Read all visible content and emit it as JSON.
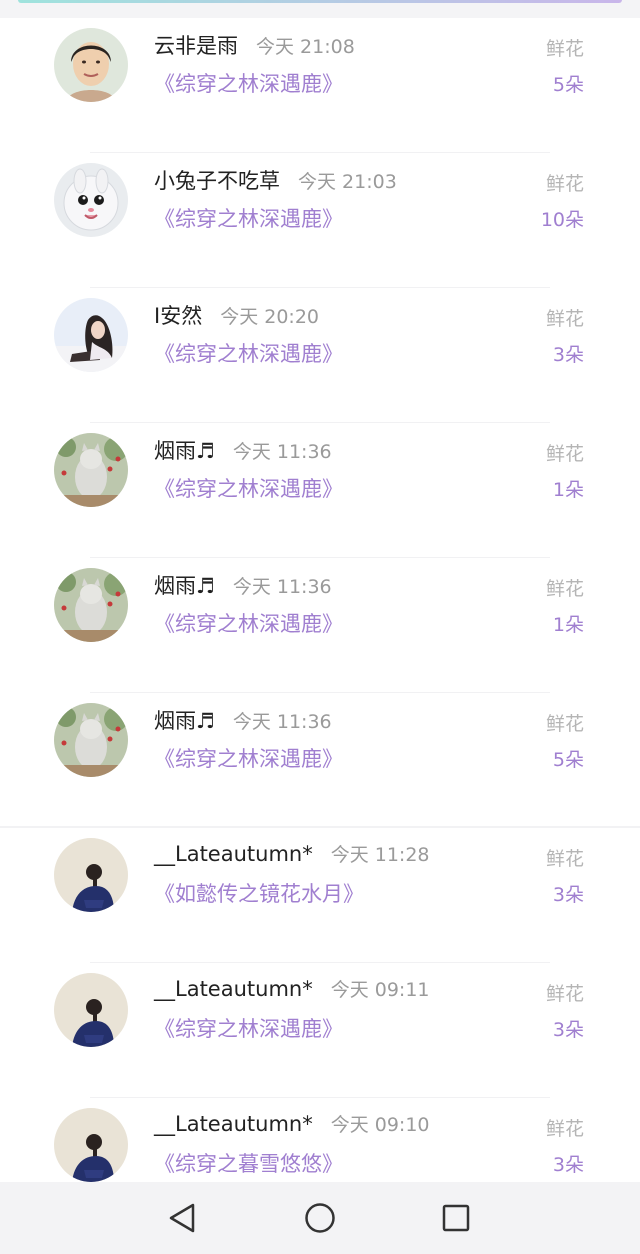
{
  "gift_records": [
    {
      "user": "云非是雨",
      "time": "今天 21:08",
      "book": "《综穿之林深遇鹿》",
      "gift_type": "鲜花",
      "count": "5朵"
    },
    {
      "user": "小兔子不吃草",
      "time": "今天 21:03",
      "book": "《综穿之林深遇鹿》",
      "gift_type": "鲜花",
      "count": "10朵"
    },
    {
      "user": "I安然",
      "time": "今天 20:20",
      "book": "《综穿之林深遇鹿》",
      "gift_type": "鲜花",
      "count": "3朵"
    },
    {
      "user": "烟雨♬",
      "time": "今天 11:36",
      "book": "《综穿之林深遇鹿》",
      "gift_type": "鲜花",
      "count": "1朵"
    },
    {
      "user": "烟雨♬",
      "time": "今天 11:36",
      "book": "《综穿之林深遇鹿》",
      "gift_type": "鲜花",
      "count": "1朵"
    },
    {
      "user": "烟雨♬",
      "time": "今天 11:36",
      "book": "《综穿之林深遇鹿》",
      "gift_type": "鲜花",
      "count": "5朵"
    },
    {
      "user": "__Lateautumn*",
      "time": "今天 11:28",
      "book": "《如懿传之镜花水月》",
      "gift_type": "鲜花",
      "count": "3朵"
    },
    {
      "user": "__Lateautumn*",
      "time": "今天 09:11",
      "book": "《综穿之林深遇鹿》",
      "gift_type": "鲜花",
      "count": "3朵"
    },
    {
      "user": "__Lateautumn*",
      "time": "今天 09:10",
      "book": "《综穿之暮雪悠悠》",
      "gift_type": "鲜花",
      "count": "3朵"
    }
  ],
  "colors": {
    "accent_purple": "#a07fd0",
    "time_gray": "#9a9a9a",
    "label_gray": "#b5b5b5",
    "name_dark": "#222222"
  },
  "navbar": {
    "icons": [
      "back-triangle-icon",
      "home-circle-icon",
      "recents-square-icon"
    ]
  }
}
